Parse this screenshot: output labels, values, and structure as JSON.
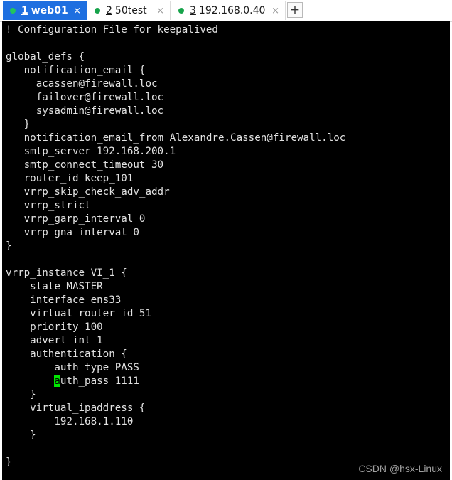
{
  "tabs": [
    {
      "number": "1",
      "title": "web01",
      "active": true,
      "dot_color": "#22c55e"
    },
    {
      "number": "2",
      "title": "50test",
      "active": false,
      "dot_color": "#16a34a"
    },
    {
      "number": "3",
      "title": "192.168.0.40",
      "active": false,
      "dot_color": "#16a34a"
    }
  ],
  "add_tab_label": "+",
  "close_glyph": "×",
  "terminal": {
    "lines": [
      "! Configuration File for keepalived",
      "",
      "global_defs {",
      "   notification_email {",
      "     acassen@firewall.loc",
      "     failover@firewall.loc",
      "     sysadmin@firewall.loc",
      "   }",
      "   notification_email_from Alexandre.Cassen@firewall.loc",
      "   smtp_server 192.168.200.1",
      "   smtp_connect_timeout 30",
      "   router_id keep_101",
      "   vrrp_skip_check_adv_addr",
      "   vrrp_strict",
      "   vrrp_garp_interval 0",
      "   vrrp_gna_interval 0",
      "}",
      "",
      "vrrp_instance VI_1 {",
      "    state MASTER",
      "    interface ens33",
      "    virtual_router_id 51",
      "    priority 100",
      "    advert_int 1",
      "    authentication {",
      "        auth_type PASS",
      "        auth_pass 1111",
      "    }",
      "    virtual_ipaddress {",
      "        192.168.1.110",
      "    }",
      "",
      "}"
    ],
    "cursor": {
      "line": 26,
      "column": 8,
      "char": "a"
    },
    "cursor_color": "#00e600"
  },
  "watermark": "CSDN @hsx-Linux",
  "colors": {
    "active_tab": "#1e6fe0",
    "terminal_bg": "#000000",
    "terminal_fg": "#e2e2e2"
  }
}
